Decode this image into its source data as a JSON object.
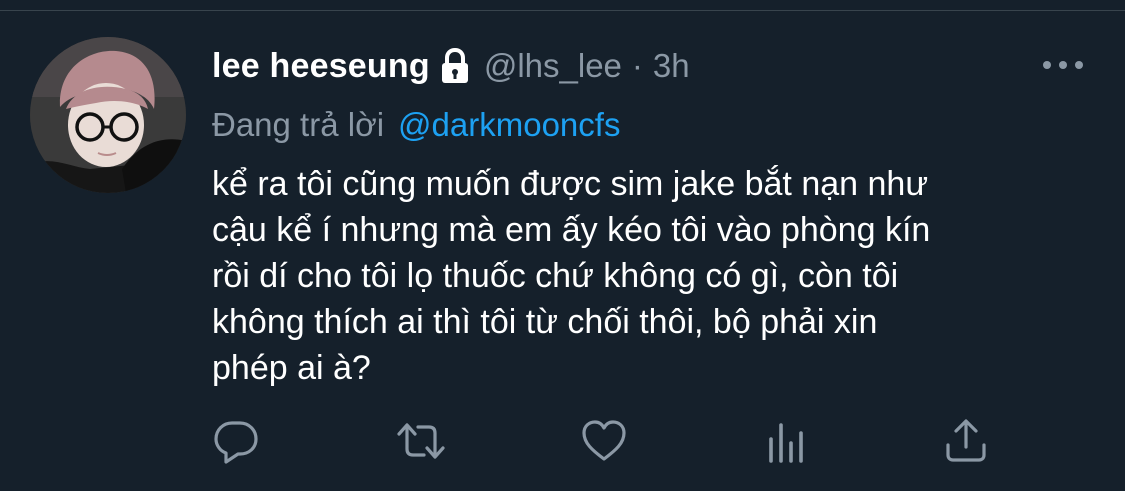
{
  "tweet": {
    "display_name": "lee heeseung",
    "handle": "@lhs_lee",
    "separator": "·",
    "time": "3h",
    "reply_prefix": "Đang trả lời",
    "reply_to": "@darkmooncfs",
    "text": "kể ra tôi cũng muốn được sim jake bắt nạn như\ncậu kể í nhưng mà em ấy kéo tôi vào phòng kín\nrồi dí cho tôi lọ thuốc chứ không có gì, còn tôi\nkhông thích ai thì tôi từ chối thôi, bộ phải xin\nphép ai à?"
  },
  "icons": {
    "lock": "lock-icon",
    "more": "more-options-icon",
    "reply": "reply-icon",
    "retweet": "retweet-icon",
    "like": "heart-icon",
    "analytics": "analytics-icon",
    "share": "share-icon"
  },
  "colors": {
    "background": "#15202b",
    "secondary_text": "#8b98a5",
    "link": "#1da1f2",
    "divider": "#38444d"
  }
}
